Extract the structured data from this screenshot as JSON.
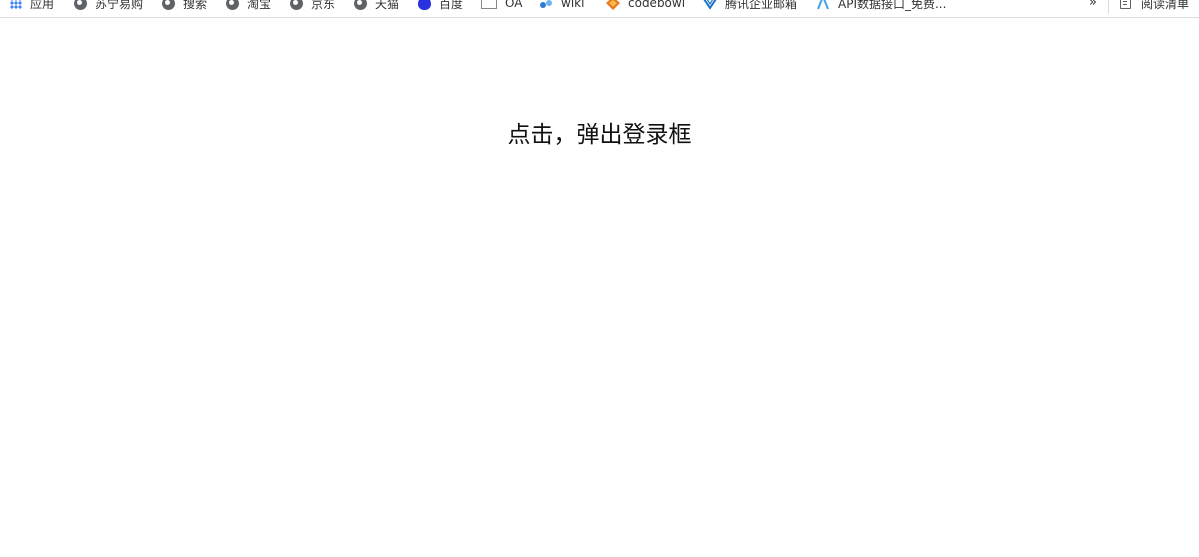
{
  "bookmarks": [
    {
      "label": "应用",
      "icon": "apps-grid-icon"
    },
    {
      "label": "苏宁易购",
      "icon": "globe-icon"
    },
    {
      "label": "搜索",
      "icon": "globe-icon"
    },
    {
      "label": "淘宝",
      "icon": "globe-icon"
    },
    {
      "label": "京东",
      "icon": "globe-icon"
    },
    {
      "label": "天猫",
      "icon": "globe-icon"
    },
    {
      "label": "百度",
      "icon": "baidu-paw-icon"
    },
    {
      "label": "OA",
      "icon": "oa-logo-icon"
    },
    {
      "label": "wiki",
      "icon": "wiki-logo-icon"
    },
    {
      "label": "codebowl",
      "icon": "codebowl-logo-icon"
    },
    {
      "label": "腾讯企业邮箱",
      "icon": "tencent-mail-icon"
    },
    {
      "label": "API数据接口_免费...",
      "icon": "api-logo-icon"
    }
  ],
  "overflow": {
    "label": "»"
  },
  "reading_list": {
    "label": "阅读清单",
    "icon": "reading-list-icon"
  },
  "main": {
    "trigger_text": "点击，弹出登录框"
  }
}
